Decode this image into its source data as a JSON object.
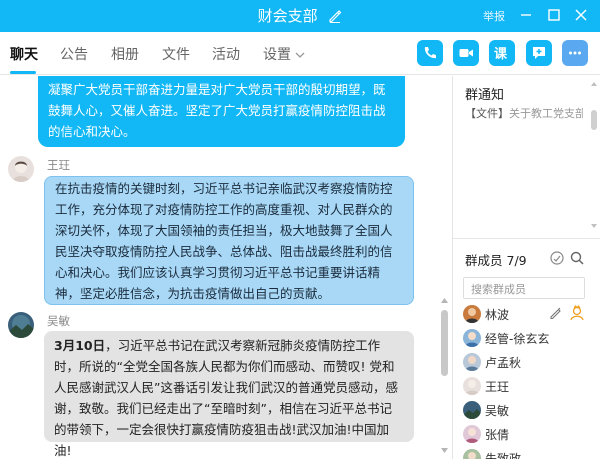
{
  "window": {
    "title": "财会支部",
    "report_label": "举报"
  },
  "tabs": [
    {
      "label": "聊天"
    },
    {
      "label": "公告"
    },
    {
      "label": "相册"
    },
    {
      "label": "文件"
    },
    {
      "label": "活动"
    },
    {
      "label": "设置"
    }
  ],
  "toolbar": {
    "course_label": "课"
  },
  "messages": [
    {
      "sender": "",
      "text": "凝聚广大党员干部奋进力量是对广大党员干部的殷切期望，既鼓舞人心，又催人奋进。坚定了广大党员打赢疫情防控阻击战的信心和决心。"
    },
    {
      "sender": "王玨",
      "text": "在抗击疫情的关键时刻，习近平总书记亲临武汉考察疫情防控工作，充分体现了对疫情防控工作的高度重视、对人民群众的深切关怀，体现了大国领袖的责任担当，极大地鼓舞了全国人民坚决夺取疫情防控人民战争、总体战、阻击战最终胜利的信心和决心。我们应该认真学习贯彻习近平总书记重要讲话精神，坚定必胜信念，为抗击疫情做出自己的贡献。"
    },
    {
      "sender": "吴敏",
      "date_bold": "3月10日",
      "text": "，习近平总书记在武汉考察新冠肺炎疫情防控工作时，所说的“全党全国各族人民都为你们而感动、而赞叹! 党和人民感谢武汉人民”这番话引发让我们武汉的普通党员感动，感谢，致敬。我们已经走出了“至暗时刻”，相信在习近平总书记的带领下，一定会很快打赢疫情防疫狙击战!武汉加油!中国加油!"
    }
  ],
  "group_notice": {
    "title": "群通知",
    "tag": "【文件】",
    "text": "关于教工党支部..."
  },
  "members": {
    "title": "群成员",
    "count": "7/9",
    "search_placeholder": "搜索群成员",
    "list": [
      {
        "name": "林波"
      },
      {
        "name": "经管-徐玄玄"
      },
      {
        "name": "卢孟秋"
      },
      {
        "name": "王玨"
      },
      {
        "name": "吴敏"
      },
      {
        "name": "张倩"
      },
      {
        "name": "朱致政"
      }
    ]
  },
  "colors": {
    "accent": "#12b7f5",
    "bubble_selected": "#a8d8f6",
    "bubble_other": "#e3e3e3"
  }
}
